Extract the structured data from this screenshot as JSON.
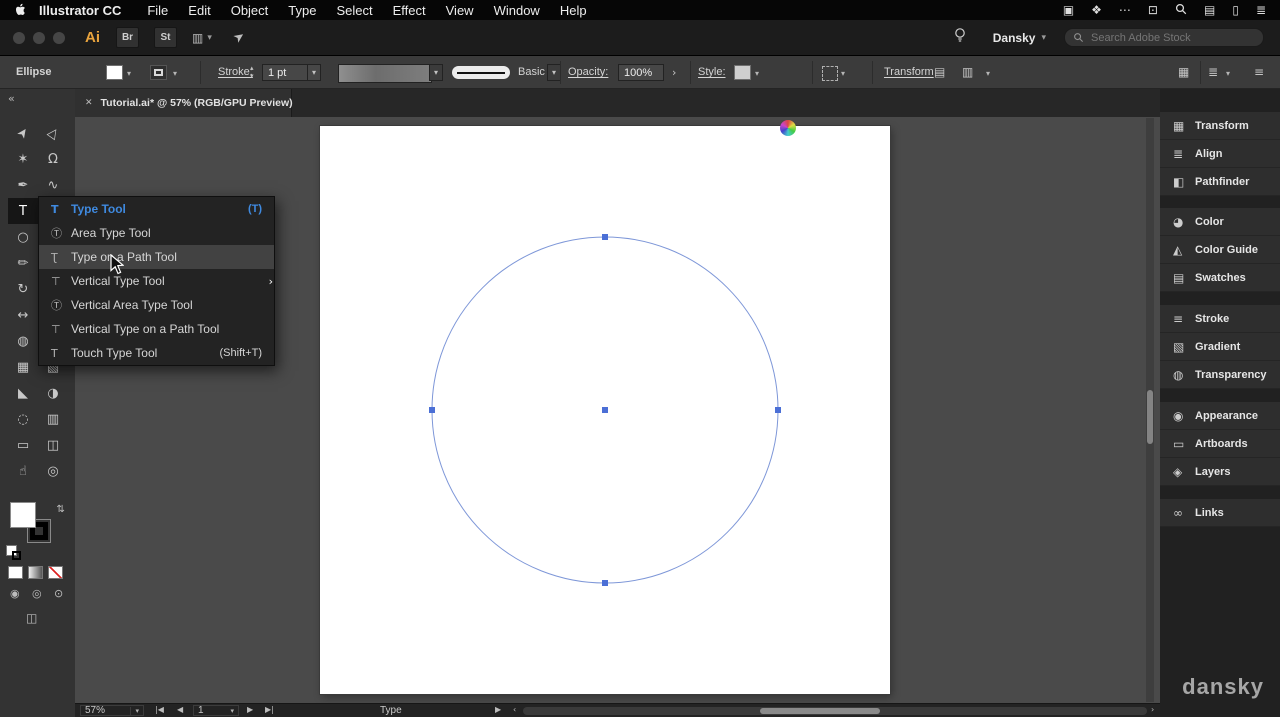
{
  "icons": {
    "caret": "▾",
    "caret_up": "▴",
    "collapse": "«",
    "close": "✕",
    "chev_left": "‹",
    "chev_right": "›",
    "play": "▶",
    "nav_first": "|◀",
    "nav_prev": "◀",
    "nav_next": "▶",
    "nav_last": "▶|",
    "swap": "⇄",
    "layout": "▥",
    "share": "➤",
    "menu_lines": "≡",
    "panel_list": "≣",
    "workspace_grid": "▦",
    "align_a": "▤",
    "align_b": "▥",
    "tearoff": "›",
    "draw_normal": "◉",
    "draw_behind": "◎",
    "draw_inside": "⊙",
    "screen_mode": "◫",
    "stepper_up": "▴",
    "stepper_down": "▾"
  },
  "menubar": {
    "app": "Illustrator CC",
    "items": [
      "File",
      "Edit",
      "Object",
      "Type",
      "Select",
      "Effect",
      "View",
      "Window",
      "Help"
    ],
    "right_icons": [
      "▣",
      "❖",
      "⋯",
      "⊡",
      "▤",
      "▯",
      "≣"
    ]
  },
  "appbar": {
    "logo": "Ai",
    "bridge_label": "Br",
    "stock_label": "St",
    "user": "Dansky",
    "search_placeholder": "Search Adobe Stock"
  },
  "controlbar": {
    "selection_label": "Ellipse",
    "stroke_label": "Stroke:",
    "stroke_weight": "1 pt",
    "brush_name": "Basic",
    "opacity_label": "Opacity:",
    "opacity_value": "100%",
    "style_label": "Style:",
    "transform_label": "Transform"
  },
  "tab": {
    "title": "Tutorial.ai* @ 57% (RGB/GPU Preview)"
  },
  "toolbar": {
    "tools": [
      {
        "name": "selection",
        "g": "➤"
      },
      {
        "name": "direct-selection",
        "g": "▷"
      },
      {
        "name": "magic-wand",
        "g": "✶"
      },
      {
        "name": "lasso",
        "g": "Ω"
      },
      {
        "name": "pen",
        "g": "✒"
      },
      {
        "name": "curvature",
        "g": "∿"
      },
      {
        "name": "type",
        "g": "T",
        "selected": true
      },
      {
        "name": "line-segment",
        "g": "╲"
      },
      {
        "name": "ellipse",
        "g": "○"
      },
      {
        "name": "paintbrush",
        "g": "✎"
      },
      {
        "name": "pencil",
        "g": "✏"
      },
      {
        "name": "shaper",
        "g": "✧"
      },
      {
        "name": "rotate",
        "g": "↻"
      },
      {
        "name": "scale",
        "g": "◿"
      },
      {
        "name": "width",
        "g": "↔"
      },
      {
        "name": "free-transform",
        "g": "▢"
      },
      {
        "name": "shape-builder",
        "g": "◍"
      },
      {
        "name": "perspective-grid",
        "g": "◺"
      },
      {
        "name": "mesh",
        "g": "▦"
      },
      {
        "name": "gradient",
        "g": "▧"
      },
      {
        "name": "eyedropper",
        "g": "◣"
      },
      {
        "name": "blend",
        "g": "◑"
      },
      {
        "name": "symbol-sprayer",
        "g": "◌"
      },
      {
        "name": "column-graph",
        "g": "▥"
      },
      {
        "name": "artboard",
        "g": "▭"
      },
      {
        "name": "slice",
        "g": "◫"
      },
      {
        "name": "hand",
        "g": "☝"
      },
      {
        "name": "zoom",
        "g": "◎"
      }
    ]
  },
  "type_menu": {
    "items": [
      {
        "icon": "T",
        "label": "Type Tool",
        "shortcut": "(T)"
      },
      {
        "icon": "Ⓣ",
        "label": "Area Type Tool",
        "shortcut": ""
      },
      {
        "icon": "Ʈ",
        "label": "Type on a Path Tool",
        "shortcut": ""
      },
      {
        "icon": "⊤",
        "label": "Vertical Type Tool",
        "shortcut": ""
      },
      {
        "icon": "Ⓣ",
        "label": "Vertical Area Type Tool",
        "shortcut": ""
      },
      {
        "icon": "⊤",
        "label": "Vertical Type on a Path Tool",
        "shortcut": ""
      },
      {
        "icon": "T",
        "label": "Touch Type Tool",
        "shortcut": "(Shift+T)"
      }
    ]
  },
  "panels": {
    "groups": [
      {
        "items": [
          {
            "i": "▦",
            "l": "Transform"
          },
          {
            "i": "≣",
            "l": "Align"
          },
          {
            "i": "◧",
            "l": "Pathfinder"
          }
        ]
      },
      {
        "items": [
          {
            "i": "◕",
            "l": "Color"
          },
          {
            "i": "◭",
            "l": "Color Guide"
          },
          {
            "i": "▤",
            "l": "Swatches"
          }
        ]
      },
      {
        "items": [
          {
            "i": "≡",
            "l": "Stroke"
          },
          {
            "i": "▧",
            "l": "Gradient"
          },
          {
            "i": "◍",
            "l": "Transparency"
          }
        ]
      },
      {
        "items": [
          {
            "i": "◉",
            "l": "Appearance"
          },
          {
            "i": "▭",
            "l": "Artboards"
          },
          {
            "i": "◈",
            "l": "Layers"
          }
        ]
      },
      {
        "items": [
          {
            "i": "∞",
            "l": "Links"
          }
        ]
      }
    ]
  },
  "canvas": {
    "selection_color": "#4b6fd6",
    "path_color": "#7e97d8"
  },
  "statusbar": {
    "zoom": "57%",
    "artboard_number": "1",
    "tool_status": "Type"
  },
  "watermark": "dansky"
}
